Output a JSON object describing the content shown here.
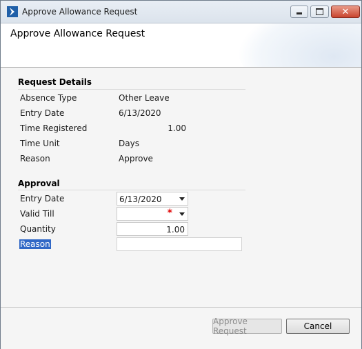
{
  "window": {
    "title": "Approve Allowance Request"
  },
  "header": {
    "title": "Approve Allowance Request"
  },
  "request_details": {
    "section_title": "Request Details",
    "rows": [
      {
        "label": "Absence Type",
        "value": "Other Leave"
      },
      {
        "label": "Entry Date",
        "value": "6/13/2020"
      },
      {
        "label": "Time Registered",
        "value": "1.00"
      },
      {
        "label": "Time Unit",
        "value": "Days"
      },
      {
        "label": "Reason",
        "value": "Approve"
      }
    ]
  },
  "approval": {
    "section_title": "Approval",
    "entry_date": {
      "label": "Entry Date",
      "value": "6/13/2020"
    },
    "valid_till": {
      "label": "Valid Till",
      "value": "",
      "required_marker": "*"
    },
    "quantity": {
      "label": "Quantity",
      "value": "1.00"
    },
    "reason": {
      "label": "Reason",
      "value": ""
    }
  },
  "footer": {
    "approve_label": "Approve Request",
    "cancel_label": "Cancel"
  },
  "colors": {
    "accent": "#3168c6",
    "required": "#e00000",
    "close_button": "#c9452f"
  }
}
